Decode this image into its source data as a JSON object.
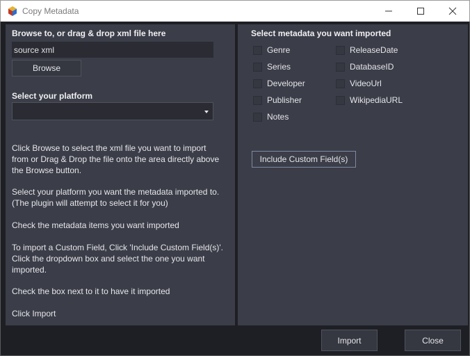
{
  "window": {
    "title": "Copy Metadata"
  },
  "left_panel": {
    "browse_heading": "Browse to, or drag & drop xml file here",
    "source_input_value": "source xml",
    "browse_button": "Browse",
    "platform_heading": "Select your platform",
    "platform_selected": "",
    "instructions": [
      "Click Browse to select the xml file you want to import",
      "from or Drag & Drop the file onto the area directly above",
      "the Browse button.",
      "Select your platform you want the metadata imported to.",
      "(The plugin will attempt to select it for you)",
      "Check the metadata items you want imported",
      "To import a Custom Field, Click 'Include Custom Field(s)'.",
      "Click the dropdown box and select the one you want",
      "imported.",
      "Check the box next to it to have it imported",
      "Click Import"
    ]
  },
  "right_panel": {
    "heading": "Select metadata you want imported",
    "checkboxes": [
      {
        "label": "Genre",
        "checked": false
      },
      {
        "label": "Series",
        "checked": false
      },
      {
        "label": "Developer",
        "checked": false
      },
      {
        "label": "Publisher",
        "checked": false
      },
      {
        "label": "Notes",
        "checked": false
      },
      {
        "label": "ReleaseDate",
        "checked": false
      },
      {
        "label": "DatabaseID",
        "checked": false
      },
      {
        "label": "VideoUrl",
        "checked": false
      },
      {
        "label": "WikipediaURL",
        "checked": false
      }
    ],
    "custom_field_button": "Include Custom Field(s)"
  },
  "footer": {
    "import_button": "Import",
    "close_button": "Close"
  },
  "colors": {
    "panel": "#3b3d48",
    "background": "#1e1f25",
    "accent_border": "#7e8aa8"
  },
  "icons": [
    "app-cube-icon",
    "minimize-icon",
    "maximize-icon",
    "close-icon",
    "chevron-down-icon"
  ]
}
